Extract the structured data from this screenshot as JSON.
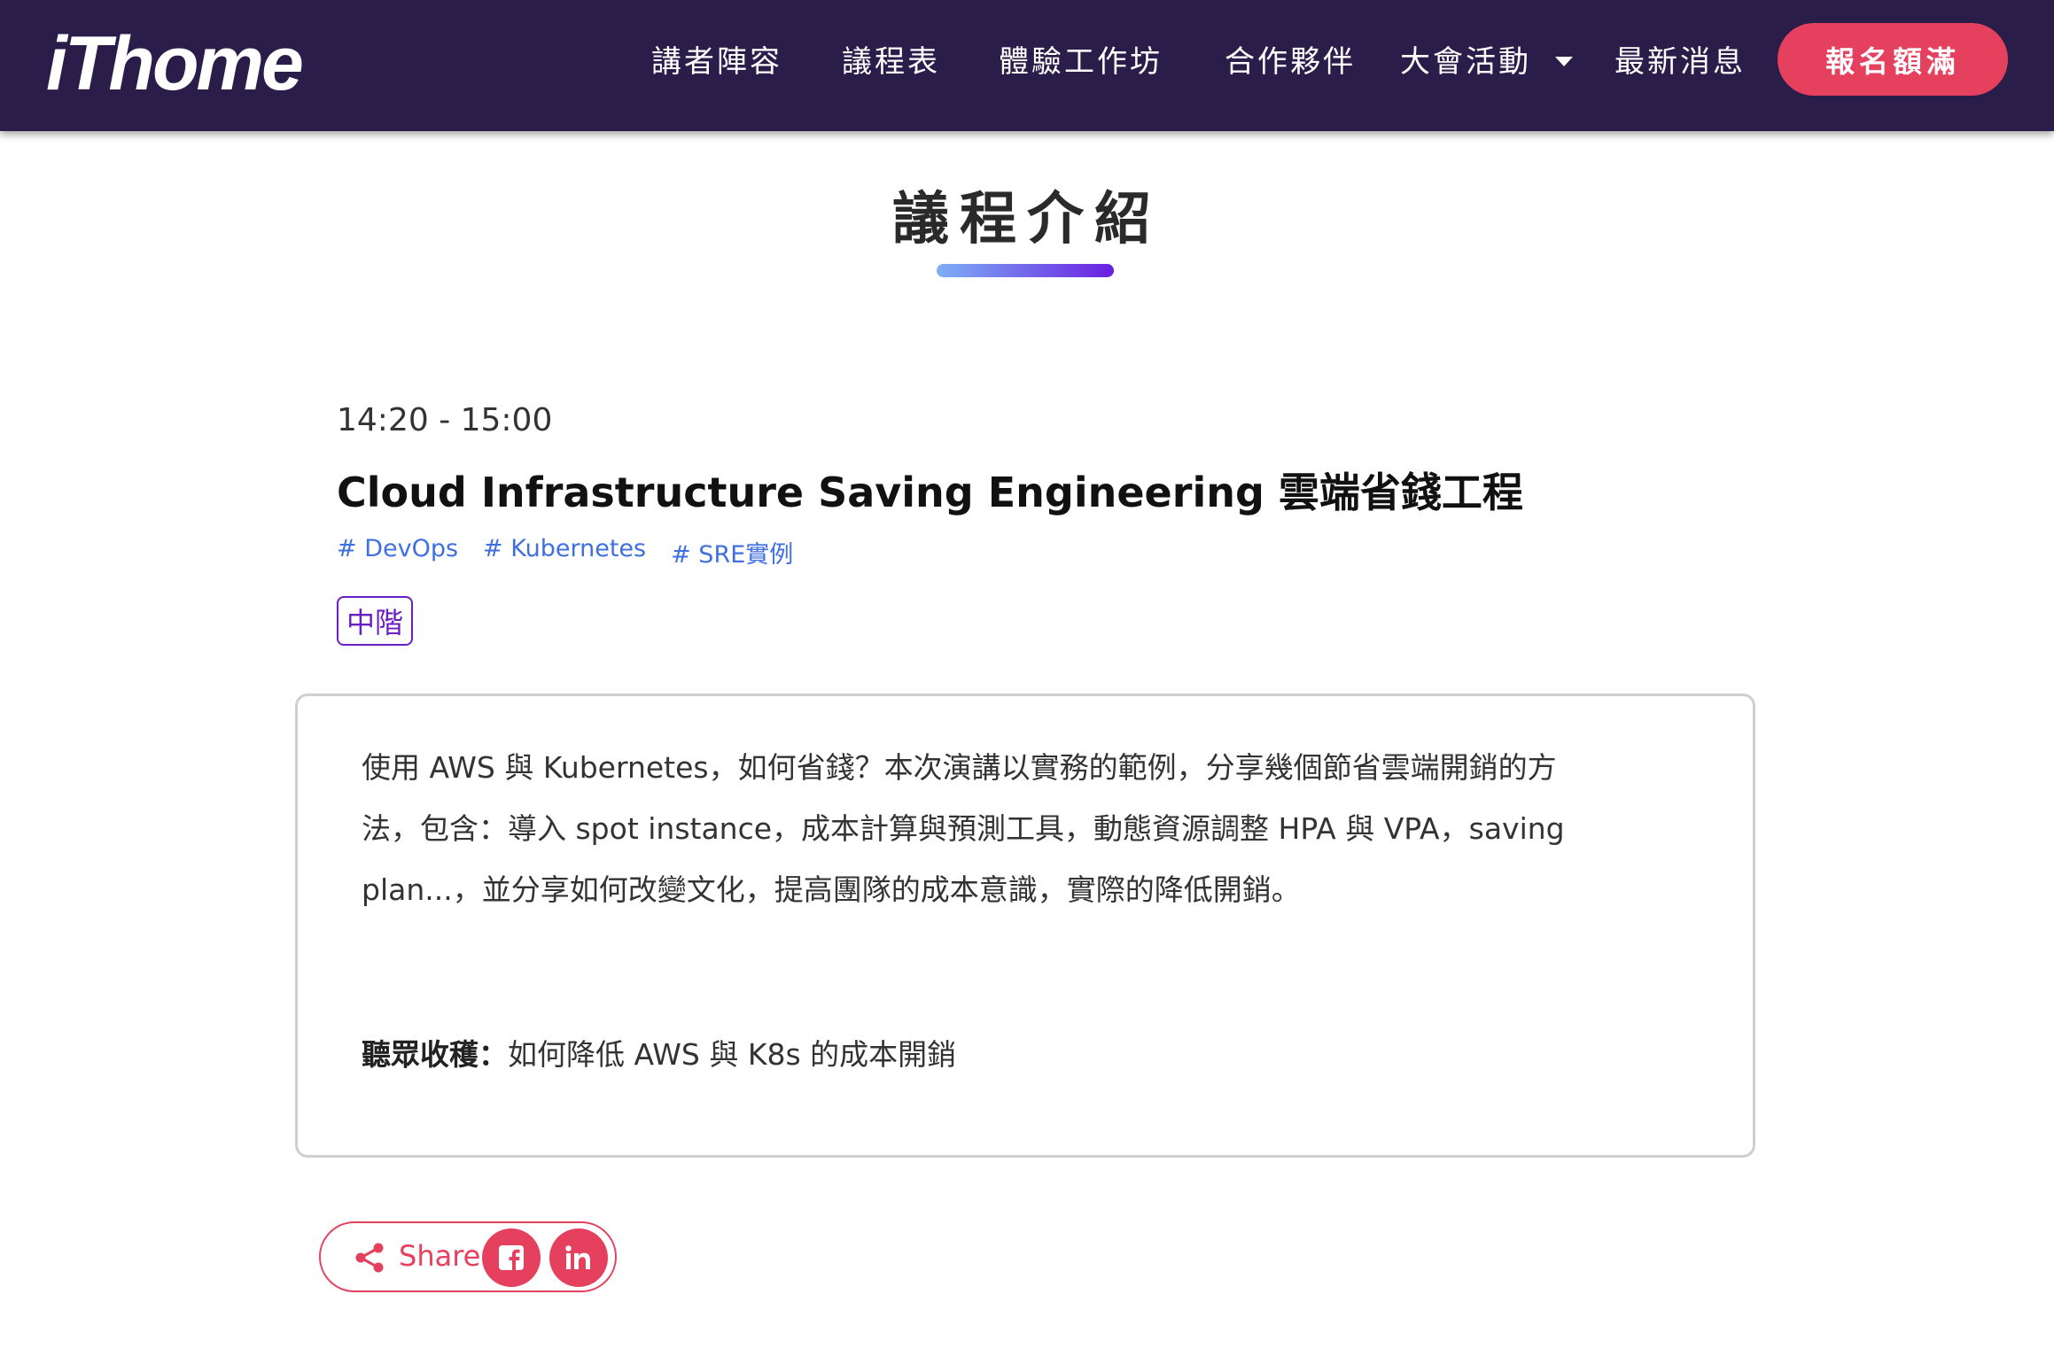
{
  "nav": {
    "logo": "iThome",
    "items": [
      "講者陣容",
      "議程表",
      "體驗工作坊",
      "合作夥伴",
      "大會活動",
      "最新消息"
    ],
    "register": "報名額滿"
  },
  "page": {
    "title": "議程介紹"
  },
  "session": {
    "time": "14:20 - 15:00",
    "title": "Cloud Infrastructure Saving Engineering 雲端省錢工程",
    "tags": [
      "# DevOps",
      "# Kubernetes",
      "# SRE實例"
    ],
    "level": "中階",
    "description": [
      "使用 AWS 與 Kubernetes，如何省錢？本次演講以實務的範例，分享幾個節省雲端開銷的方",
      "法，包含：導入 spot instance，成本計算與預測工具，動態資源調整 HPA 與 VPA，saving",
      "plan...，並分享如何改變文化，提高團隊的成本意識，實際的降低開銷。"
    ],
    "takeaway_label": "聽眾收穫：",
    "takeaway_text": "如何降低 AWS 與 K8s 的成本開銷"
  },
  "share": {
    "label": "Share",
    "icons": [
      "share-icon",
      "facebook-icon",
      "linkedin-icon"
    ]
  }
}
